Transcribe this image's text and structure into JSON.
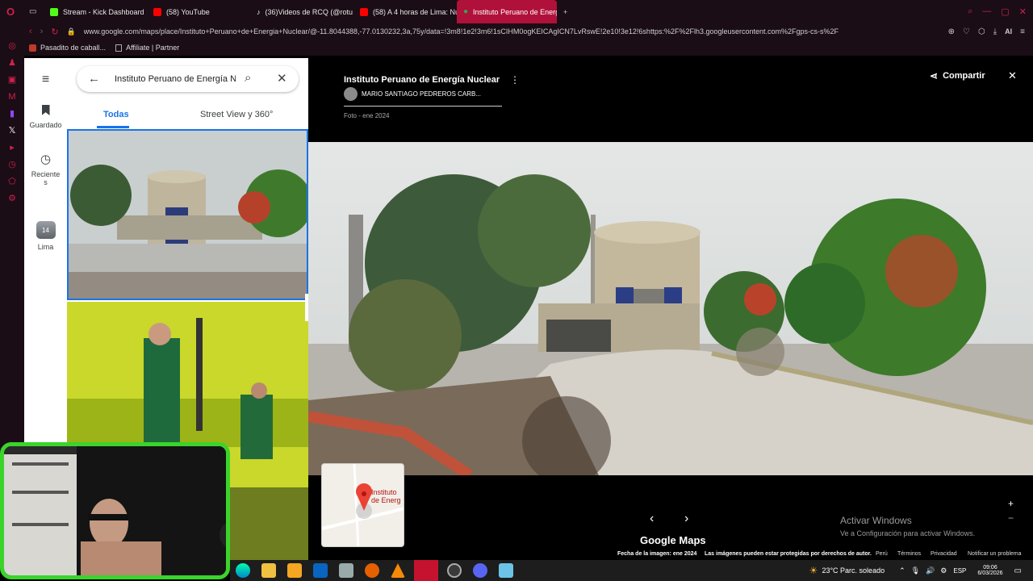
{
  "browser": {
    "tabs": [
      {
        "label": "Stream - Kick Dashboard",
        "icon": "kick-icon",
        "color": "#53fc18"
      },
      {
        "label": "(58) YouTube",
        "icon": "youtube-icon",
        "color": "#ff0000"
      },
      {
        "label": "(36)Videos de RCQ (@rotu",
        "icon": "tiktok-icon",
        "color": "#ffffff"
      },
      {
        "label": "(58) A 4 horas de Lima: Nu",
        "icon": "youtube-icon",
        "color": "#ff0000"
      },
      {
        "label": "Instituto Peruano de Energ",
        "icon": "maps-icon",
        "color": "#34a853"
      }
    ],
    "url": "www.google.com/maps/place/Instituto+Peruano+de+Energia+Nuclear/@-11.8044388,-77.0130232,3a,75y/data=!3m8!1e2!3m6!1sCIHM0ogKEICAgICN7LvRswE!2e10!3e12!6shttps:%2F%2Flh3.googleusercontent.com%2Fgps-cs-s%2F",
    "bookmarks": [
      "Pasadito de caball...",
      "Affiliate | Partner"
    ],
    "ai_label": "AI"
  },
  "maps_rail": {
    "items": [
      {
        "label": "Guardado",
        "icon": "bookmark-icon"
      },
      {
        "label": "Reciente\ns",
        "icon": "history-icon"
      },
      {
        "label": "Lima",
        "icon": "city-thumbnail-icon",
        "badge": "14"
      }
    ]
  },
  "panel": {
    "search_value": "Instituto Peruano de Energía Nuclear",
    "tabs": [
      "Todas",
      "Street View y 360°"
    ],
    "active_tab": 0,
    "accent": "#1a73e8"
  },
  "viewer": {
    "title": "Instituto Peruano de Energía Nuclear",
    "author": "MARIO SANTIAGO PEDREROS CARB...",
    "date": "Foto - ene 2024",
    "share_label": "Compartir",
    "brand": "Google Maps",
    "minimap_label": "Instituto\nde Energ",
    "footer": [
      "Fecha de la imagen: ene 2024",
      "Las imágenes pueden estar protegidas por derechos de autor.",
      "Perú",
      "Términos",
      "Privacidad",
      "Notificar un problema"
    ],
    "watermark_title": "Activar Windows",
    "watermark_sub": "Ve a Configuración para activar Windows."
  },
  "taskbar": {
    "weather": "23°C  Parc. soleado",
    "lang": "ESP",
    "time": "09:06",
    "date": "6/03/2026"
  }
}
